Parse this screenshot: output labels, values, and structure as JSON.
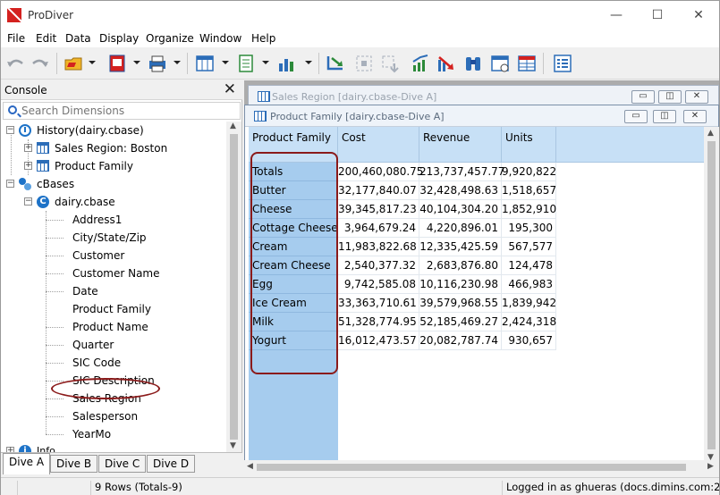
{
  "window": {
    "title": "ProDiver",
    "controls": [
      "—",
      "☐",
      "✕"
    ]
  },
  "menu": [
    "File",
    "Edit",
    "Data",
    "Display",
    "Organize",
    "Window",
    "Help"
  ],
  "toolbar_icons": [
    "undo-icon",
    "redo-icon",
    "open-dive-icon",
    "dive-book-icon",
    "print-icon",
    "table-layout-icon",
    "document-icon",
    "chart-icon",
    "drill-icon",
    "drill-fit-icon",
    "drill-down-icon",
    "trend-up-icon",
    "trend-down-icon",
    "binoculars-icon",
    "calendar-grid-icon",
    "grid-window-icon",
    "list-icon"
  ],
  "console": {
    "title": "Console",
    "close": "✕",
    "search_placeholder": "Search Dimensions",
    "tree": {
      "history": {
        "label": "History(dairy.cbase)",
        "children": [
          "Sales Region: Boston",
          "Product Family"
        ]
      },
      "cbases": {
        "label": "cBases",
        "cbase": {
          "label": "dairy.cbase",
          "dimensions": [
            "Address1",
            "City/State/Zip",
            "Customer",
            "Customer Name",
            "Date",
            "Product Family",
            "Product Name",
            "Quarter",
            "SIC Code",
            "SIC Description",
            "Sales Region",
            "Salesperson",
            "YearMo"
          ]
        }
      },
      "info_partial": "Info"
    },
    "dive_tabs": [
      "Dive A",
      "Dive B",
      "Dive C",
      "Dive D"
    ]
  },
  "windows": {
    "back_title": "Sales Region [dairy.cbase-Dive A]",
    "front_title": "Product Family [dairy.cbase-Dive A]"
  },
  "grid": {
    "headers": [
      "Product Family",
      "Cost",
      "Revenue",
      "Units"
    ],
    "rows": [
      {
        "label": "Totals",
        "cost": "200,460,080.75",
        "revenue": "213,737,457.77",
        "units": "9,920,822"
      },
      {
        "label": "Butter",
        "cost": "32,177,840.07",
        "revenue": "32,428,498.63",
        "units": "1,518,657"
      },
      {
        "label": "Cheese",
        "cost": "39,345,817.23",
        "revenue": "40,104,304.20",
        "units": "1,852,910"
      },
      {
        "label": "Cottage Cheese",
        "cost": "3,964,679.24",
        "revenue": "4,220,896.01",
        "units": "195,300"
      },
      {
        "label": "Cream",
        "cost": "11,983,822.68",
        "revenue": "12,335,425.59",
        "units": "567,577"
      },
      {
        "label": "Cream Cheese",
        "cost": "2,540,377.32",
        "revenue": "2,683,876.80",
        "units": "124,478"
      },
      {
        "label": "Egg",
        "cost": "9,742,585.08",
        "revenue": "10,116,230.98",
        "units": "466,983"
      },
      {
        "label": "Ice Cream",
        "cost": "33,363,710.61",
        "revenue": "39,579,968.55",
        "units": "1,839,942"
      },
      {
        "label": "Milk",
        "cost": "51,328,774.95",
        "revenue": "52,185,469.27",
        "units": "2,424,318"
      },
      {
        "label": "Yogurt",
        "cost": "16,012,473.57",
        "revenue": "20,082,787.74",
        "units": "930,657"
      }
    ]
  },
  "status": {
    "rows": "9 Rows (Totals-9)",
    "login": "Logged in as ghueras (docs.dimins.com:2"
  }
}
